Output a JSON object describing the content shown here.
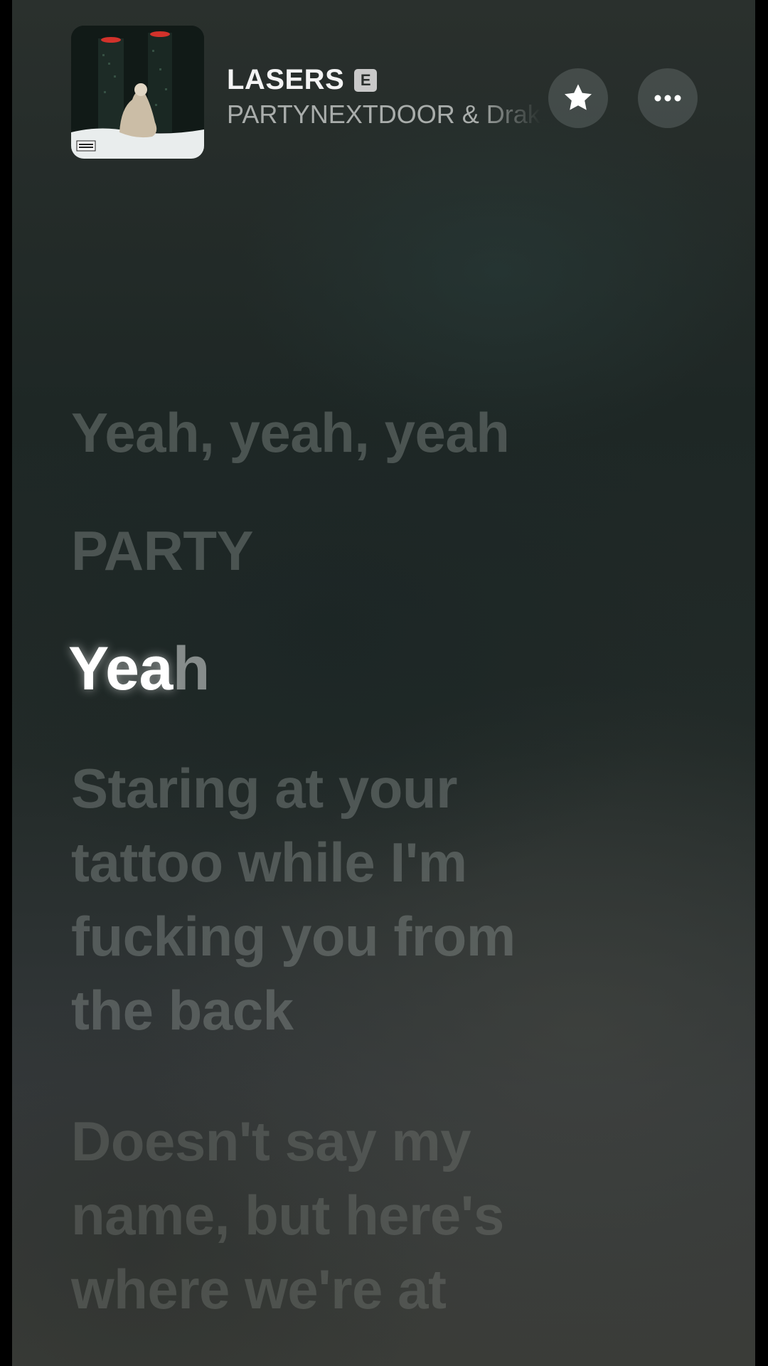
{
  "now_playing": {
    "title": "LASERS",
    "explicit_badge": "E",
    "artist": "PARTYNEXTDOOR & Drake",
    "artwork_icon": "album-art",
    "favorite_icon": "star-icon",
    "more_icon": "ellipsis-icon"
  },
  "lyrics": {
    "lines": [
      {
        "text": "Yeah, yeah, yeah",
        "state": "past"
      },
      {
        "text": "PARTY",
        "state": "past"
      },
      {
        "text_sung": "Yea",
        "text_unsung": "h",
        "state": "current"
      },
      {
        "wrapped": [
          "Staring at your",
          "tattoo while I'm",
          "fucking you from",
          "the back"
        ],
        "state": "upcoming"
      },
      {
        "wrapped": [
          "Doesn't say my",
          "name, but here's",
          "where we're at"
        ],
        "state": "upcoming"
      }
    ]
  },
  "colors": {
    "background": "#1e2725",
    "active_lyric": "#ffffff",
    "inactive_lyric": "#969e9b"
  }
}
